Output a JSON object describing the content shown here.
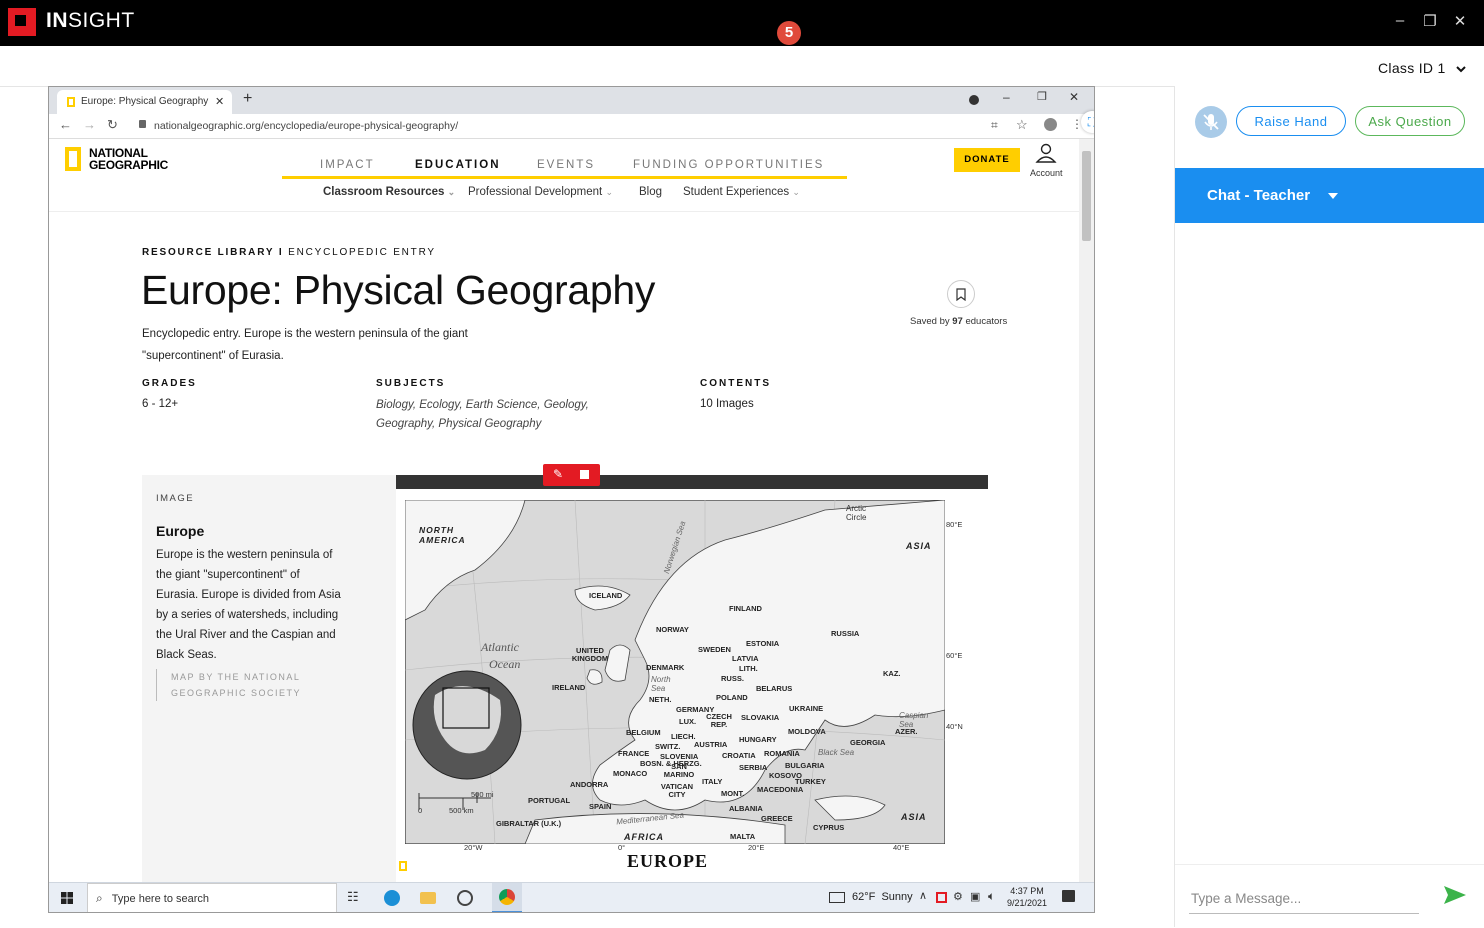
{
  "app": {
    "brand_bold": "IN",
    "brand_light": "SIGHT",
    "notification_count": "5"
  },
  "header": {
    "class_select": "Class ID 1"
  },
  "browser": {
    "tab_title": "Europe: Physical Geography | Na",
    "url": "nationalgeographic.org/encyclopedia/europe-physical-geography/"
  },
  "site": {
    "logo_line1": "NATIONAL",
    "logo_line2": "GEOGRAPHIC",
    "nav": [
      "IMPACT",
      "EDUCATION",
      "EVENTS",
      "FUNDING OPPORTUNITIES"
    ],
    "subnav": [
      "Classroom Resources",
      "Professional Development",
      "Blog",
      "Student Experiences"
    ],
    "donate": "DONATE",
    "account": "Account"
  },
  "article": {
    "kicker_bold": "RESOURCE LIBRARY",
    "kicker_sep": "I",
    "kicker_rest": "ENCYCLOPEDIC ENTRY",
    "title": "Europe: Physical Geography",
    "desc_line1": "Encyclopedic entry. Europe is the western peninsula of the giant",
    "desc_line2": "\"supercontinent\" of Eurasia.",
    "saved_prefix": "Saved by ",
    "saved_count": "97",
    "saved_suffix": " educators",
    "grades_label": "GRADES",
    "grades_value": "6 - 12+",
    "subjects_label": "SUBJECTS",
    "subjects_line1": "Biology, Ecology, Earth Science, Geology,",
    "subjects_line2": "Geography, Physical Geography",
    "contents_label": "CONTENTS",
    "contents_value": "10 Images"
  },
  "image_panel": {
    "label": "IMAGE",
    "title": "Europe",
    "caption_lines": [
      "Europe is the western peninsula of",
      "the giant \"supercontinent\" of",
      "Eurasia. Europe is divided from Asia",
      "by a series of watersheds, including",
      "the Ural River and the Caspian and",
      "Black Seas."
    ],
    "credit_line1": "MAP BY THE NATIONAL",
    "credit_line2": "GEOGRAPHIC SOCIETY"
  },
  "map": {
    "title": "EUROPE",
    "labels": [
      "NORTH AMERICA",
      "ASIA",
      "Arctic Circle",
      "ICELAND",
      "FINLAND",
      "RUSSIA",
      "NORWAY",
      "SWEDEN",
      "ESTONIA",
      "LATVIA",
      "LITH.",
      "RUSS.",
      "BELARUS",
      "UNITED KINGDOM",
      "DENMARK",
      "IRELAND",
      "NETH.",
      "POLAND",
      "GERMANY",
      "UKRAINE",
      "BELGIUM",
      "LUX.",
      "CZECH REP.",
      "SLOVAKIA",
      "MOLDOVA",
      "KAZ.",
      "FRANCE",
      "SWITZ.",
      "AUSTRIA",
      "HUNGARY",
      "ROMANIA",
      "GEORGIA",
      "AZER.",
      "SLOVENIA",
      "CROATIA",
      "SERBIA",
      "BULGARIA",
      "KOSOVO",
      "TURKEY",
      "MONACO",
      "SAN MARINO",
      "VATICAN CITY",
      "ITALY",
      "MONT.",
      "MACEDONIA",
      "ANDORRA",
      "PORTUGAL",
      "SPAIN",
      "ALBANIA",
      "GREECE",
      "CYPRUS",
      "GIBRALTAR (U.K.)",
      "MALTA",
      "AFRICA",
      "ASIA",
      "Atlantic",
      "Ocean",
      "Black Sea",
      "Caspian Sea",
      "Norwegian Sea",
      "North Sea",
      "Mediterranean Sea",
      "LIECH.",
      "BOSN. & HERZG."
    ],
    "lat_labels": [
      "80°E",
      "60°E",
      "40°N"
    ],
    "lon_labels": [
      "20°W",
      "0°",
      "20°E",
      "40°E"
    ],
    "scale_mi": "500 mi",
    "scale_km": "500 km",
    "scale_zero": "0"
  },
  "taskbar": {
    "search_placeholder": "Type here to search",
    "weather": "62°F  Sunny",
    "time": "4:37 PM",
    "date": "9/21/2021"
  },
  "right_panel": {
    "raise_hand": "Raise Hand",
    "ask_question": "Ask Question",
    "chat_title": "Chat - Teacher",
    "message_placeholder": "Type a Message..."
  },
  "colors": {
    "brand_red": "#e31b23",
    "chat_blue": "#1a8ef0",
    "raise_hand_blue": "#1a8ef0",
    "ask_green": "#5cb85c",
    "donate_yellow": "#ffce00"
  }
}
